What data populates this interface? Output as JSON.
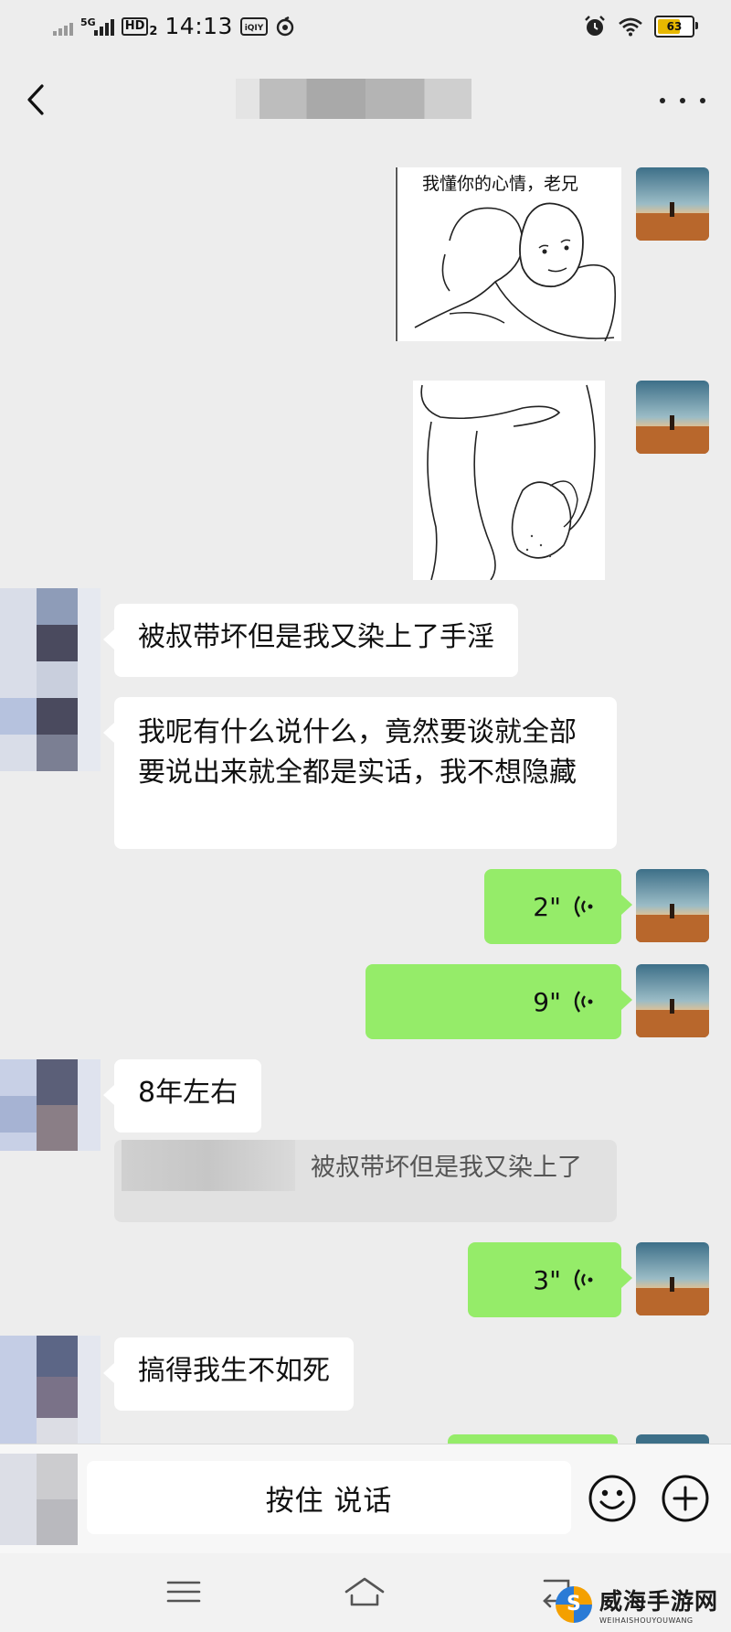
{
  "status_bar": {
    "network": "5G",
    "hd_badge": "HD",
    "hd_sub": "2",
    "time": "14:13",
    "battery": "63"
  },
  "header": {
    "back_icon": "chevron-left-icon",
    "title_blurred": true,
    "more_icon": "ellipsis-icon"
  },
  "messages": [
    {
      "side": "right",
      "type": "image",
      "caption": "我懂你的心情，老兄"
    },
    {
      "side": "right",
      "type": "image-continued"
    },
    {
      "side": "left",
      "type": "text",
      "text": "被叔带坏但是我又染上了手淫"
    },
    {
      "side": "left",
      "type": "text",
      "text": "我呢有什么说什么，竟然要谈就全部要说出来就全都是实话，我不想隐藏"
    },
    {
      "side": "right",
      "type": "voice",
      "duration": "2\""
    },
    {
      "side": "right",
      "type": "voice",
      "duration": "9\""
    },
    {
      "side": "left",
      "type": "text",
      "text": "8年左右",
      "quote": "被叔带坏但是我又染上了"
    },
    {
      "side": "right",
      "type": "voice",
      "duration": "3\""
    },
    {
      "side": "left",
      "type": "text",
      "text": "搞得我生不如死"
    }
  ],
  "input_bar": {
    "voice_button_label": "按住 说话",
    "emoji_icon": "smiley-icon",
    "plus_icon": "plus-circle-icon"
  },
  "system_nav": {
    "menu_icon": "menu-icon",
    "home_icon": "home-icon",
    "back_icon": "back-icon"
  },
  "watermark": {
    "logo_letter": "S",
    "name": "威海手游网",
    "domain": "WEIHAISHOUYOUWANG"
  },
  "colors": {
    "background": "#ededed",
    "sent_bubble": "#95ec69",
    "received_bubble": "#ffffff"
  }
}
